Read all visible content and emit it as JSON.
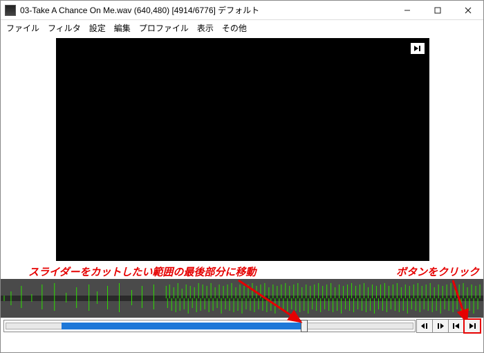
{
  "window": {
    "title": "03-Take A Chance On Me.wav (640,480)   [4914/6776]  デフォルト"
  },
  "menu": {
    "items": [
      "ファイル",
      "フィルタ",
      "設定",
      "編集",
      "プロファイル",
      "表示",
      "その他"
    ]
  },
  "annotations": {
    "slider_text": "スライダーをカットしたい範囲の最後部分に移動",
    "button_text": "ボタンをクリック"
  },
  "controls": {
    "btn_step_back": "step-back",
    "btn_step_fwd": "step-forward",
    "btn_prev_frame": "prev-frame",
    "btn_next_frame": "next-frame"
  },
  "slider": {
    "fill_left_pct": 14,
    "fill_right_pct": 73,
    "thumb_pct": 73
  }
}
